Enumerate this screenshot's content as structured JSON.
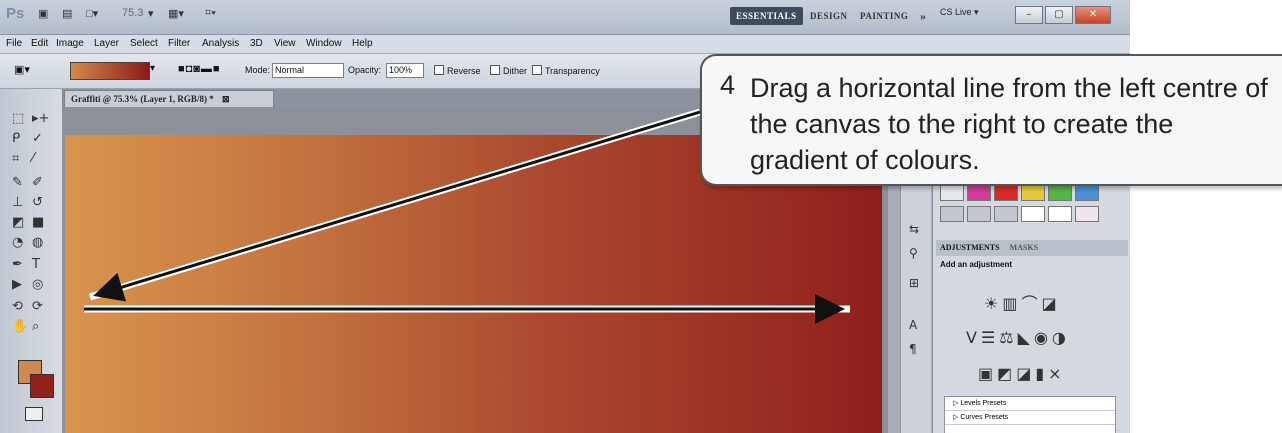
{
  "app": {
    "logo": "Ps",
    "zoom_display": "75.3",
    "workspaces": [
      "ESSENTIALS",
      "DESIGN",
      "PAINTING",
      "»"
    ],
    "cs_live": "CS Live ▾"
  },
  "menu": [
    "File",
    "Edit",
    "Image",
    "Layer",
    "Select",
    "Filter",
    "Analysis",
    "3D",
    "View",
    "Window",
    "Help"
  ],
  "options": {
    "mode_label": "Mode:",
    "mode_value": "Normal",
    "opacity_label": "Opacity:",
    "opacity_value": "100%",
    "reverse_label": "Reverse",
    "dither_label": "Dither",
    "transparency_label": "Transparency"
  },
  "document": {
    "tab_title": "Graffiti @ 75.3% (Layer 1, RGB/8) *"
  },
  "adjustments": {
    "tab_active": "ADJUSTMENTS",
    "tab_other": "MASKS",
    "heading": "Add an adjustment",
    "presets": [
      "Levels Presets",
      "Curves Presets"
    ]
  },
  "callout": {
    "number": "4",
    "text": "Drag a horizontal line from the left centre of the canvas to the right to create the gradient of colours."
  },
  "colors": {
    "gradient_start": "#d9944e",
    "gradient_end": "#901e1c",
    "foreground": "#d08a4f",
    "background": "#93201c"
  }
}
